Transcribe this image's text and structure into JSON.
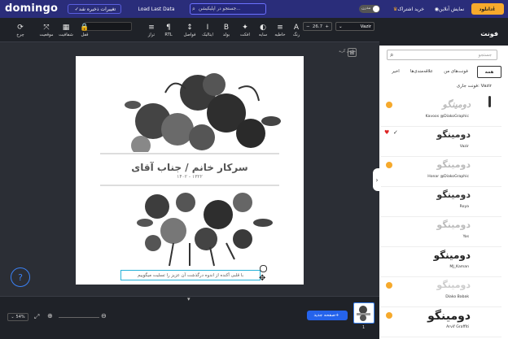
{
  "app": {
    "logo": "domingo"
  },
  "topbar": {
    "save_status": "تغییرات ذخیره شد",
    "load_last_data": "Load Last Data",
    "search_placeholder": "جستجو در اپلیکیشن...",
    "toggle_label": "مدرن",
    "buy_subscription": "خرید اشتراک",
    "online_preview": "نمایش آنلاین",
    "download": "دانلود"
  },
  "toolbar": {
    "font_name": "Vazir",
    "font_size": "26.7",
    "tools": [
      {
        "label": "رنگ",
        "icon": "A"
      },
      {
        "label": "خاطیه",
        "icon": "≡"
      },
      {
        "label": "سایه",
        "icon": "◐"
      },
      {
        "label": "افکت",
        "icon": "✦"
      },
      {
        "label": "بولد",
        "icon": "B"
      },
      {
        "label": "ایتالیک",
        "icon": "I"
      },
      {
        "label": "فواصل",
        "icon": "↕"
      },
      {
        "label": "RTL",
        "icon": "¶"
      },
      {
        "label": "تراز",
        "icon": "≡"
      },
      {
        "label": "قفل",
        "icon": "🔒"
      },
      {
        "label": "شفافیت",
        "icon": "▦"
      },
      {
        "label": "موقعیت",
        "icon": "⤧"
      },
      {
        "label": "چرخ",
        "icon": "⟳"
      }
    ]
  },
  "canvas": {
    "title": "سرکار خانم / جناب آقای",
    "years": "۱۴۰۲ - ۱۳۲۲",
    "bottom_text": "با قلبی آکنده از اندوه درگذشت آن عزیز را تسلیت میگوییم",
    "grid_label": "نمایش گرید"
  },
  "bottombar": {
    "zoom": "54%",
    "new_page": "صفحه جدید",
    "page_number": "1"
  },
  "panel": {
    "title": "فونت",
    "search_placeholder": "جستجو",
    "tabs": [
      "همه",
      "فونت‌های من",
      "علاقه‌مندی‌ها",
      "اخیر"
    ],
    "current_font_label": "فونت جاری: Vazir",
    "fonts": [
      {
        "preview": "دومینگو",
        "name": "Kavoos @DiakoGraphic",
        "premium": true,
        "favorite": false
      },
      {
        "preview": "دومینگو",
        "name": "Vazir",
        "premium": false,
        "favorite": true
      },
      {
        "preview": "دومینگو",
        "name": "Honar @DiakoGraphic",
        "premium": true,
        "favorite": false
      },
      {
        "preview": "دومینگو",
        "name": "Roya",
        "premium": false,
        "favorite": false
      },
      {
        "preview": "دومینگو",
        "name": "Yas",
        "premium": false,
        "favorite": false
      },
      {
        "preview": "دومینگو",
        "name": "MJ_Kaman",
        "premium": false,
        "favorite": false
      },
      {
        "preview": "دومینگو",
        "name": "Diako Babak",
        "premium": true,
        "favorite": false
      },
      {
        "preview": "دومینگو",
        "name": "Arvif Graffiti",
        "premium": true,
        "favorite": false
      }
    ]
  }
}
